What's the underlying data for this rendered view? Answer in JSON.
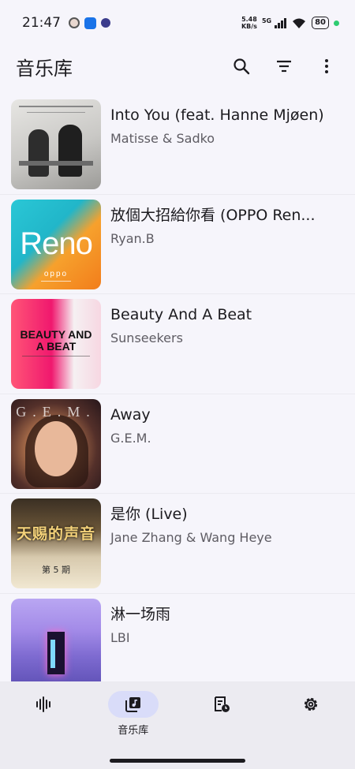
{
  "status_bar": {
    "time": "21:47",
    "net_speed_value": "5.48",
    "net_speed_unit": "KB/s",
    "net_type": "5G",
    "battery": "80"
  },
  "app_bar": {
    "title": "音乐库",
    "actions": [
      "search-icon",
      "filter-icon",
      "more-vert-icon"
    ]
  },
  "songs": [
    {
      "title": "Into You (feat. Hanne Mjøen)",
      "artist": "Matisse & Sadko"
    },
    {
      "title": "放個大招給你看 (OPPO Ren...",
      "artist": "Ryan.B",
      "cover_text": "Reno",
      "cover_sub": "oppo"
    },
    {
      "title": "Beauty And A Beat",
      "artist": "Sunseekers",
      "cover_text": "BEAUTY AND A BEAT"
    },
    {
      "title": "Away",
      "artist": "G.E.M.",
      "cover_text": "G.E.M."
    },
    {
      "title": "是你 (Live)",
      "artist": "Jane Zhang & Wang Heye",
      "cover_text": "天赐的声音",
      "cover_sub": "第 5 期"
    },
    {
      "title": "淋一场雨",
      "artist": "LBI"
    }
  ],
  "bottom_nav": {
    "items": [
      {
        "icon": "waveform-icon",
        "label": ""
      },
      {
        "icon": "music-library-icon",
        "label": "音乐库",
        "active": true
      },
      {
        "icon": "playlist-history-icon",
        "label": ""
      },
      {
        "icon": "settings-icon",
        "label": ""
      }
    ]
  },
  "colors": {
    "background": "#f6f5fb",
    "nav_background": "#ecebf1",
    "active_pill": "#d9dcf9",
    "battery_dot": "#2ecc71"
  }
}
